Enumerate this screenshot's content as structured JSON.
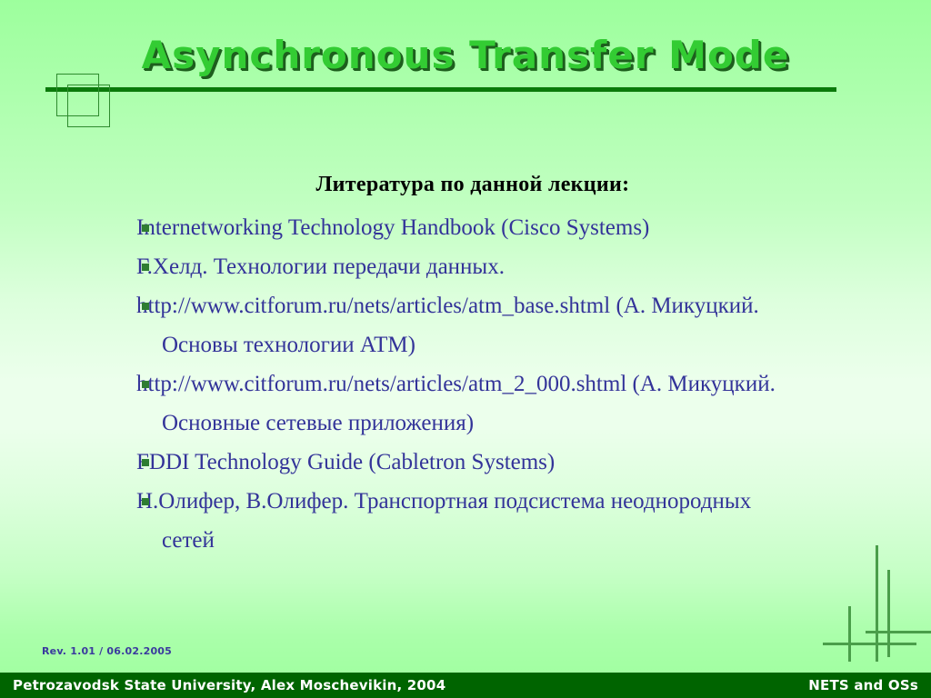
{
  "slide": {
    "title": "Asynchronous Transfer Mode",
    "heading": "Литература по данной лекции:",
    "bullets": [
      "Internetworking Technology Handbook (Cisco Systems)",
      "Г.Хелд. Технологии передачи данных.",
      "http://www.citforum.ru/nets/articles/atm_base.shtml (А. Микуцкий. Основы технологии ATM)",
      "http://www.citforum.ru/nets/articles/atm_2_000.shtml (А. Микуцкий. Основные сетевые приложения)",
      "FDDI Technology Guide (Cabletron Systems)",
      "Н.Олифер, В.Олифер. Транспортная подсистема неоднородных сетей"
    ],
    "revision": "Rev. 1.01  / 06.02.2005",
    "footer_left": "Petrozavodsk State University, Alex Moschevikin, 2004",
    "footer_right": "NETS and OSs"
  },
  "colors": {
    "title_fill": "#33cc33",
    "title_shadow": "#1d5e1d",
    "rule": "#0a7a0a",
    "body_text": "#333399",
    "heading_text": "#000000",
    "bullet_marker": "#2e7d32",
    "footer_bar": "#006400",
    "footer_text": "#ffffff",
    "revision_text": "#3a3a9e",
    "deco_line": "#4a9e4a",
    "background_top": "#9dff9d",
    "background_mid": "#ecffec",
    "background_bottom": "#a2ffa2"
  },
  "icons": {
    "bullet": "square-bullet-icon",
    "deco_squares": "overlapping-squares-icon",
    "deco_crosshatch": "crosshatch-lines-icon"
  }
}
